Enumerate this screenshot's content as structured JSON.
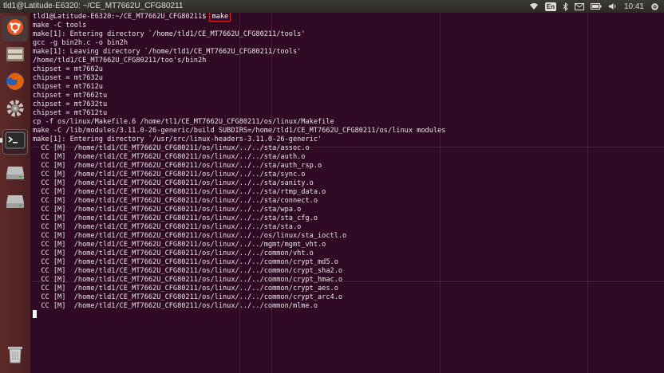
{
  "window": {
    "title": "tld1@Latitude-E6320: ~/CE_MT7662U_CFG80211"
  },
  "tray": {
    "keyboard_label": "En",
    "clock": "10:41"
  },
  "launcher": {
    "items": [
      {
        "name": "dash-home-icon"
      },
      {
        "name": "file-manager-icon"
      },
      {
        "name": "firefox-icon"
      },
      {
        "name": "system-settings-icon"
      },
      {
        "name": "terminal-icon"
      },
      {
        "name": "drive-icon"
      },
      {
        "name": "drive-icon-2"
      },
      {
        "name": "trash-icon"
      }
    ]
  },
  "terminal": {
    "prompt": "tld1@Latitude-E6320:~/CE_MT7662U_CFG80211$ ",
    "command": "make",
    "lines": [
      "make -C tools",
      "make[1]: Entering directory `/home/tld1/CE_MT7662U_CFG80211/tools'",
      "gcc -g bin2h.c -o bin2h",
      "make[1]: Leaving directory `/home/tld1/CE_MT7662U_CFG80211/tools'",
      "/home/tld1/CE_MT7662U_CFG80211/too's/bin2h",
      "chipset = mt7662u",
      "chipset = mt7632u",
      "chipset = mt7612u",
      "chipset = mt7662tu",
      "chipset = mt7632tu",
      "chipset = mt7612tu",
      "cp -f os/linux/Makefile.6 /home/tl1/CE_MT7662U_CFG80211/os/linux/Makefile",
      "make -C /lib/modules/3.11.0-26-generic/build SUBDIRS=/home/tld1/CE_MT7662U_CFG80211/os/linux modules",
      "make[1]: Entering directory `/usr/src/linux-headers-3.11.0-26-generic'",
      "  CC [M]  /home/tld1/CE_MT7662U_CFG80211/os/linux/../../sta/assoc.o",
      "  CC [M]  /home/tld1/CE_MT7662U_CFG80211/os/linux/../../sta/auth.o",
      "  CC [M]  /home/tld1/CE_MT7662U_CFG80211/os/linux/../../sta/auth_rsp.o",
      "  CC [M]  /home/tld1/CE_MT7662U_CFG80211/os/linux/../../sta/sync.o",
      "  CC [M]  /home/tld1/CE_MT7662U_CFG80211/os/linux/../../sta/sanity.o",
      "  CC [M]  /home/tld1/CE_MT7662U_CFG80211/os/linux/../../sta/rtmp_data.o",
      "  CC [M]  /home/tld1/CE_MT7662U_CFG80211/os/linux/../../sta/connect.o",
      "  CC [M]  /home/tld1/CE_MT7662U_CFG80211/os/linux/../../sta/wpa.o",
      "  CC [M]  /home/tld1/CE_MT7662U_CFG80211/os/linux/../../sta/sta_cfg.o",
      "  CC [M]  /home/tld1/CE_MT7662U_CFG80211/os/linux/../../sta/sta.o",
      "  CC [M]  /home/tld1/CE_MT7662U_CFG80211/os/linux/../../os/linux/sta_ioctl.o",
      "  CC [M]  /home/tld1/CE_MT7662U_CFG80211/os/linux/../../mgmt/mgmt_vht.o",
      "  CC [M]  /home/tld1/CE_MT7662U_CFG80211/os/linux/../../common/vht.o",
      "  CC [M]  /home/tld1/CE_MT7662U_CFG80211/os/linux/../../common/crypt_md5.o",
      "  CC [M]  /home/tld1/CE_MT7662U_CFG80211/os/linux/../../common/crypt_sha2.o",
      "  CC [M]  /home/tld1/CE_MT7662U_CFG80211/os/linux/../../common/crypt_hmac.o",
      "  CC [M]  /home/tld1/CE_MT7662U_CFG80211/os/linux/../../common/crypt_aes.o",
      "  CC [M]  /home/tld1/CE_MT7662U_CFG80211/os/linux/../../common/crypt_arc4.o",
      "  CC [M]  /home/tld1/CE_MT7662U_CFG80211/os/linux/../../common/mlme.o"
    ]
  },
  "colors": {
    "terminal_bg": "#300a24",
    "highlight": "#e02020",
    "launcher_bg": "#5d2a28"
  }
}
